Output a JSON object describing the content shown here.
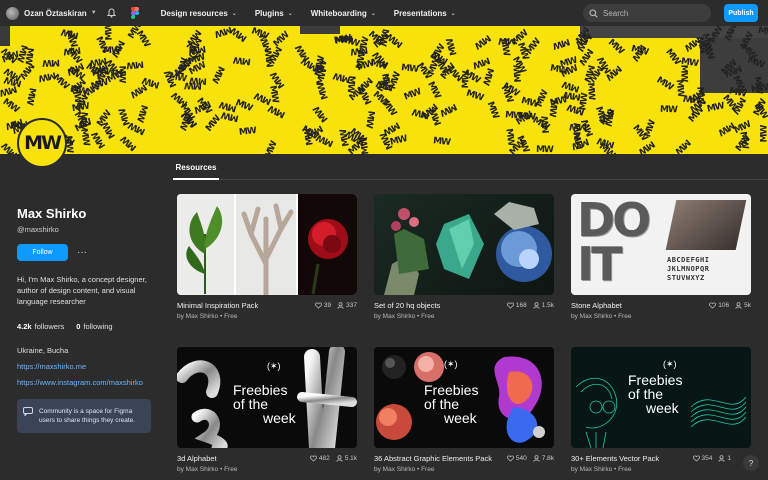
{
  "topnav": {
    "user_name": "Ozan Öztaskiran",
    "links": [
      {
        "label": "Design resources"
      },
      {
        "label": "Plugins"
      },
      {
        "label": "Whiteboarding"
      },
      {
        "label": "Presentations"
      }
    ],
    "search_placeholder": "Search",
    "publish_label": "Publish"
  },
  "banner": {
    "logo_text": "MW"
  },
  "tabs": {
    "resources": "Resources"
  },
  "profile": {
    "name": "Max Shirko",
    "handle": "@maxshirko",
    "follow_label": "Follow",
    "more_label": "···",
    "bio": "Hi, I'm Max Shirko, a concept designer, author of design content, and visual language researcher",
    "followers_count": "4.2k",
    "followers_label": "followers",
    "following_count": "0",
    "following_label": "following",
    "location": "Ukraine, Bucha",
    "link1": "https://maxshirko.me",
    "link2": "https://www.instagram.com/maxshirko",
    "community_note": "Community is a space for Figma users to share things they create."
  },
  "cards": [
    {
      "title": "Minimal Inspiration Pack",
      "author": "by Max Shirko",
      "price": "Free",
      "likes": "39",
      "users": "337"
    },
    {
      "title": "Set of 20 hq objects",
      "author": "by Max Shirko",
      "price": "Free",
      "likes": "168",
      "users": "1.5k"
    },
    {
      "title": "Stone Alphabet",
      "author": "by Max Shirko",
      "price": "Free",
      "likes": "106",
      "users": "5k"
    },
    {
      "title": "3d Alphabet",
      "author": "by Max Shirko",
      "price": "Free",
      "likes": "482",
      "users": "5.1k"
    },
    {
      "title": "36 Abstract Graphic Elements Pack",
      "author": "by Max Shirko",
      "price": "Free",
      "likes": "540",
      "users": "7.8k"
    },
    {
      "title": "30+ Elements Vector Pack",
      "author": "by Max Shirko",
      "price": "Free",
      "likes": "354",
      "users": "1"
    }
  ],
  "thumb_text": {
    "freebies": "Freebies",
    "of_the": "of the",
    "week": "week",
    "mark": "(✶)",
    "do_it": "DO IT",
    "alphabet_row1": "ABCDEFGHI",
    "alphabet_row2": "JKLMNOPQR",
    "alphabet_row3": "STUVWXYZ"
  },
  "help_label": "?",
  "colors": {
    "accent": "#0d99ff",
    "banner": "#f7e20a",
    "bg": "#2c2c2c"
  }
}
